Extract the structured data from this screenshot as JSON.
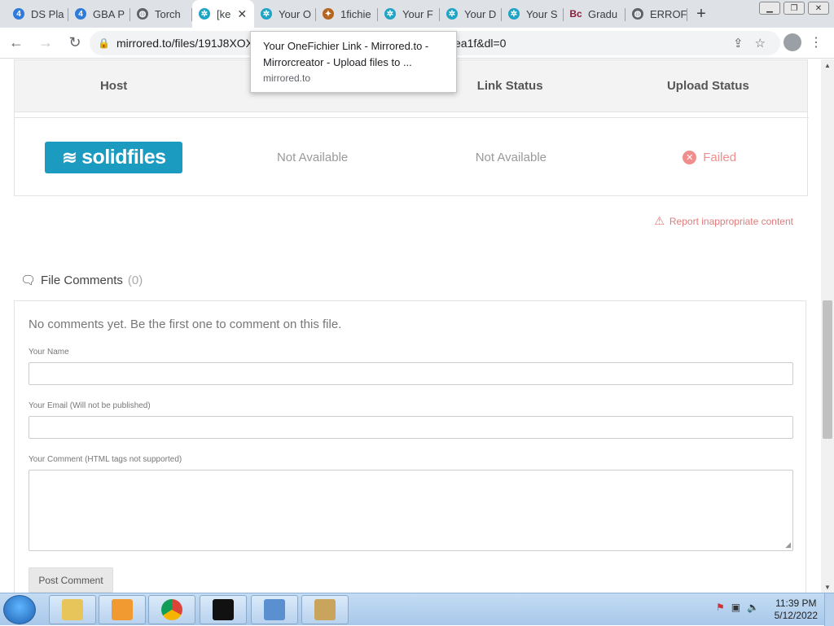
{
  "browser": {
    "tabs": [
      {
        "title": "DS Pla",
        "favicon": "4",
        "color": "#2f7bd9"
      },
      {
        "title": "GBA P",
        "favicon": "4",
        "color": "#2f7bd9"
      },
      {
        "title": "Torch",
        "favicon": "globe",
        "color": "#5f6368"
      },
      {
        "title": "[ke",
        "favicon": "gear",
        "color": "#1fa4c4",
        "active": true
      },
      {
        "title": "Your O",
        "favicon": "gear",
        "color": "#1fa4c4"
      },
      {
        "title": "1fichie",
        "favicon": "fox",
        "color": "#b5651d"
      },
      {
        "title": "Your F",
        "favicon": "gear",
        "color": "#1fa4c4"
      },
      {
        "title": "Your D",
        "favicon": "gear",
        "color": "#1fa4c4"
      },
      {
        "title": "Your S",
        "favicon": "gear",
        "color": "#1fa4c4"
      },
      {
        "title": "Gradu",
        "favicon": "Bc",
        "color": "#8b1c3a"
      },
      {
        "title": "ERROF",
        "favicon": "globe",
        "color": "#5f6368"
      }
    ],
    "url": "mirrored.to/files/191J8XOX",
    "url_tail": "ea1f&dl=0",
    "tooltip": {
      "title": "Your OneFichier Link - Mirrored.to - Mirrorcreator - Upload files to ...",
      "domain": "mirrored.to"
    }
  },
  "host_table": {
    "headers": [
      "Host",
      "",
      "Link Status",
      "Upload Status"
    ],
    "row": {
      "host_logo": "solidfiles",
      "col2": "Not Available",
      "link_status": "Not Available",
      "upload_status": "Failed"
    }
  },
  "report_link": "Report inappropriate content",
  "comments": {
    "title": "File Comments",
    "count": "(0)",
    "empty_text": "No comments yet. Be the first one to comment on this file.",
    "name_label": "Your Name",
    "email_label": "Your Email (Will not be published)",
    "comment_label": "Your Comment (HTML tags not supported)",
    "post_button": "Post Comment"
  },
  "taskbar": {
    "time": "11:39 PM",
    "date": "5/12/2022"
  },
  "colors": {
    "solidfiles_brand": "#1a9bbf",
    "failed": "#f08e8e",
    "report": "#e07a7a"
  }
}
